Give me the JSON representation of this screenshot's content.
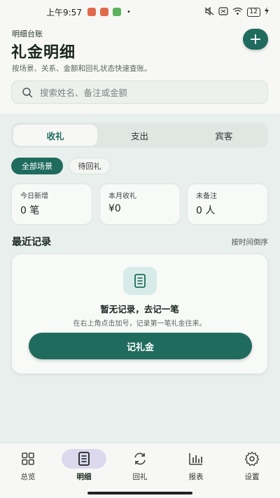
{
  "status_bar": {
    "time": "上午9:57",
    "battery": "12"
  },
  "header": {
    "section_label": "明细台账",
    "title": "礼金明细",
    "subtitle": "按场景、关系、金额和回礼状态快速查账。",
    "add_label": "+"
  },
  "search": {
    "placeholder": "搜索姓名、备注或金额"
  },
  "tabs": [
    {
      "label": "收礼",
      "active": true
    },
    {
      "label": "支出",
      "active": false
    },
    {
      "label": "宾客",
      "active": false
    }
  ],
  "filters": [
    {
      "label": "全部场景",
      "active": true
    },
    {
      "label": "待回礼",
      "active": false
    }
  ],
  "stats": [
    {
      "label": "今日新增",
      "value": "0 笔"
    },
    {
      "label": "本月收礼",
      "value": "¥0"
    },
    {
      "label": "未备注",
      "value": "0 人"
    }
  ],
  "recent": {
    "title": "最近记录",
    "sort": "按时间倒序"
  },
  "empty_state": {
    "icon": "document-icon",
    "title": "暂无记录，去记一笔",
    "description": "在右上角点击加号，记录第一笔礼金往来。",
    "button": "记礼金"
  },
  "bottom_nav": [
    {
      "label": "总览",
      "icon": "grid-icon",
      "active": false
    },
    {
      "label": "明细",
      "icon": "document-icon",
      "active": true
    },
    {
      "label": "回礼",
      "icon": "refresh-icon",
      "active": false
    },
    {
      "label": "报表",
      "icon": "bar-chart-icon",
      "active": false
    },
    {
      "label": "设置",
      "icon": "gear-icon",
      "active": false
    }
  ],
  "colors": {
    "primary": "#1f6b5e",
    "background": "#e9efec",
    "nav_active_pill": "#dcd8ee"
  }
}
